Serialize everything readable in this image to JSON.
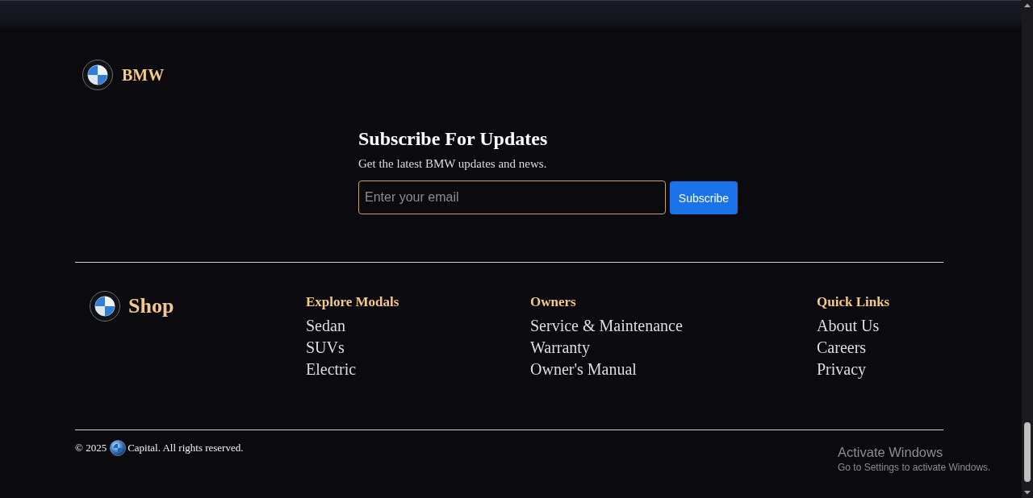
{
  "header": {
    "brand": "BMW"
  },
  "subscribe": {
    "title": "Subscribe For Updates",
    "subtitle": "Get the latest BMW updates and news.",
    "email_field": {
      "placeholder": "Enter your email"
    },
    "button": "Subscribe"
  },
  "footer": {
    "brand": "Shop",
    "columns": [
      {
        "heading": "Explore Modals",
        "links": [
          "Sedan",
          "SUVs",
          "Electric"
        ]
      },
      {
        "heading": "Owners",
        "links": [
          "Service & Maintenance",
          "Warranty",
          "Owner's Manual"
        ]
      },
      {
        "heading": "Quick Links",
        "links": [
          "About Us",
          "Careers",
          "Privacy"
        ]
      }
    ],
    "copyright": {
      "year": "© 2025",
      "text": "Capital. All rights reserved."
    }
  },
  "system_notice": {
    "title": "Activate Windows",
    "subtitle": "Go to Settings to activate Windows."
  }
}
